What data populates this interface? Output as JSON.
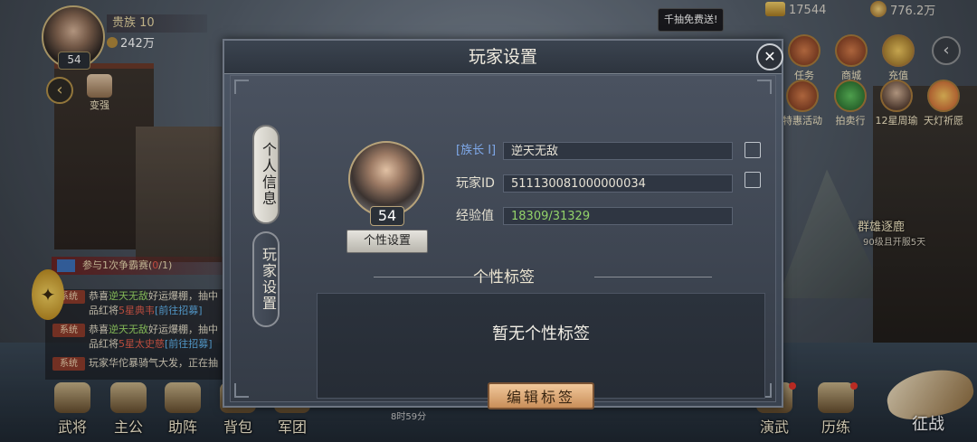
{
  "player": {
    "rank": "贵族 10",
    "power": "242万",
    "level": "54"
  },
  "currency": {
    "gold": "17544",
    "coin": "776.2万"
  },
  "free_draw": "千抽免费送!",
  "top_features": [
    {
      "label": "任务",
      "icon": "task-icon"
    },
    {
      "label": "商城",
      "icon": "shop-icon"
    },
    {
      "label": "充值",
      "icon": "recharge-icon"
    },
    {
      "label": "特惠活动",
      "icon": "sale-icon"
    },
    {
      "label": "拍卖行",
      "icon": "auction-icon"
    },
    {
      "label": "12星周瑜",
      "icon": "hero-icon"
    },
    {
      "label": "天灯祈愿",
      "icon": "lantern-icon"
    }
  ],
  "left": {
    "strengthen": "变强",
    "quest": {
      "text": "参与1次争霸赛(",
      "progress": "0",
      "total": "/1)"
    }
  },
  "chat": [
    {
      "tag": "系统",
      "pre": "恭喜",
      "name": "逆天无敌",
      "mid": "好运爆棚，抽中",
      "l2a": "品红将",
      "hero": "5星典韦",
      "link": "[前往招募]"
    },
    {
      "tag": "系统",
      "pre": "恭喜",
      "name": "逆天无敌",
      "mid": "好运爆棚，抽中",
      "l2a": "品红将",
      "hero": "5星太史慈",
      "link": "[前往招募]"
    },
    {
      "tag": "系统",
      "pre": "玩家",
      "name": "",
      "mid": "华佗暴骑气大发，正在抽",
      "l2a": "",
      "hero": "",
      "link": ""
    }
  ],
  "bottom_nav": [
    "武将",
    "主公",
    "助阵",
    "背包",
    "军团",
    "演武",
    "历练"
  ],
  "timer": "8时59分",
  "battle": "征战",
  "event": {
    "title": "群雄逐鹿",
    "sub": "90级且开服5天"
  },
  "dialog": {
    "title": "玩家设置",
    "tabs": [
      "个人信息",
      "玩家设置"
    ],
    "profile_level": "54",
    "profile_button": "个性设置",
    "rank_label": "[族长 I]",
    "name": "逆天无敌",
    "id_label": "玩家ID",
    "id_value": "511130081000000034",
    "exp_label": "经验值",
    "exp_value": "18309/31329",
    "section_title": "个性标签",
    "empty_tag": "暂无个性标签",
    "edit_button": "编辑标签"
  }
}
